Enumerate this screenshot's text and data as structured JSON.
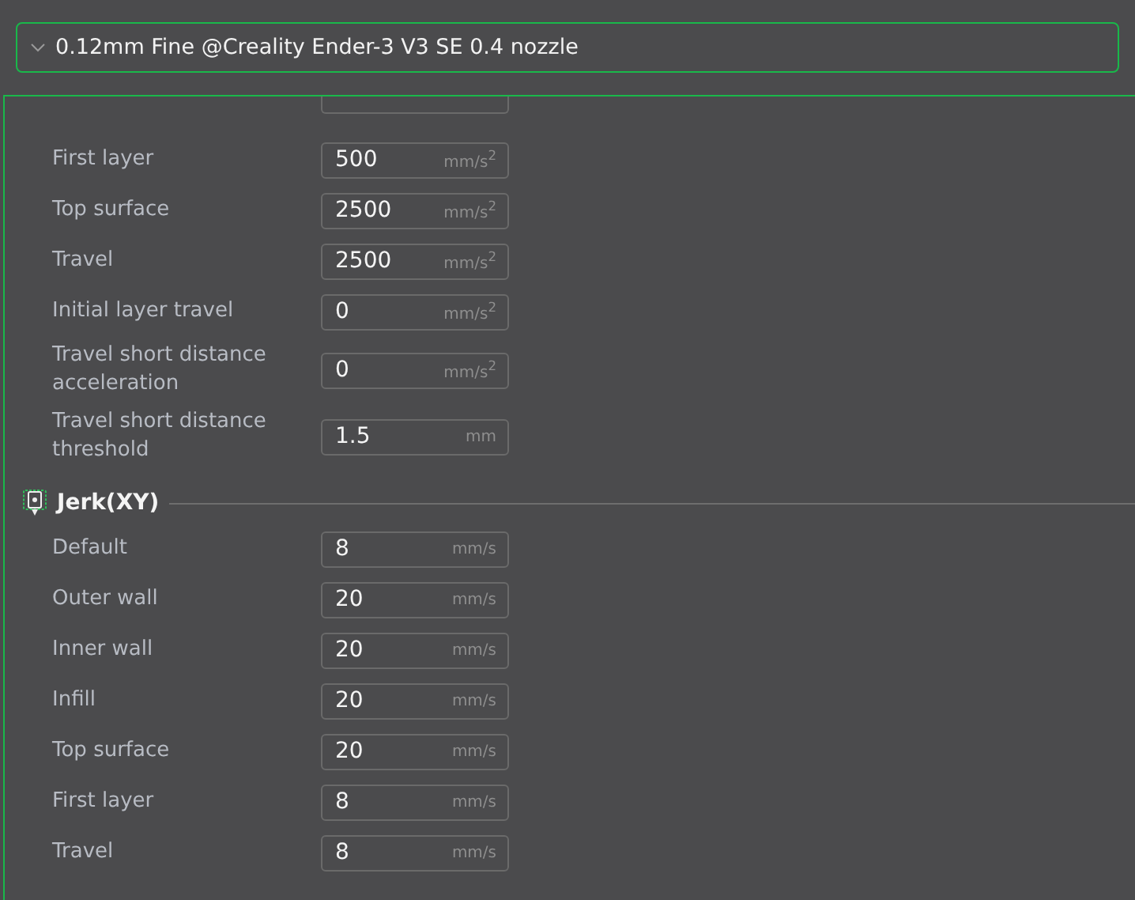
{
  "preset": {
    "label": "0.12mm Fine @Creality Ender-3 V3 SE 0.4 nozzle"
  },
  "sections": [
    {
      "kind": "rows",
      "rows": [
        {
          "label": "First layer",
          "value": "500",
          "unit": "mm/s$^{2}$"
        },
        {
          "label": "Top surface",
          "value": "2500",
          "unit": "mm/s$^{2}$"
        },
        {
          "label": "Travel",
          "value": "2500",
          "unit": "mm/s$^{2}$"
        },
        {
          "label": "Initial layer travel",
          "value": "0",
          "unit": "mm/s$^{2}$"
        },
        {
          "label": "Travel short distance acceleration",
          "value": "0",
          "unit": "mm/s$^{2}$"
        },
        {
          "label": "Travel short distance threshold",
          "value": "1.5",
          "unit": "mm"
        }
      ]
    },
    {
      "kind": "group",
      "title": "Jerk(XY)",
      "rows": [
        {
          "label": "Default",
          "value": "8",
          "unit": "mm/s"
        },
        {
          "label": "Outer wall",
          "value": "20",
          "unit": "mm/s"
        },
        {
          "label": "Inner wall",
          "value": "20",
          "unit": "mm/s"
        },
        {
          "label": "Infill",
          "value": "20",
          "unit": "mm/s"
        },
        {
          "label": "Top surface",
          "value": "20",
          "unit": "mm/s"
        },
        {
          "label": "First layer",
          "value": "8",
          "unit": "mm/s"
        },
        {
          "label": "Travel",
          "value": "8",
          "unit": "mm/s"
        }
      ]
    }
  ]
}
